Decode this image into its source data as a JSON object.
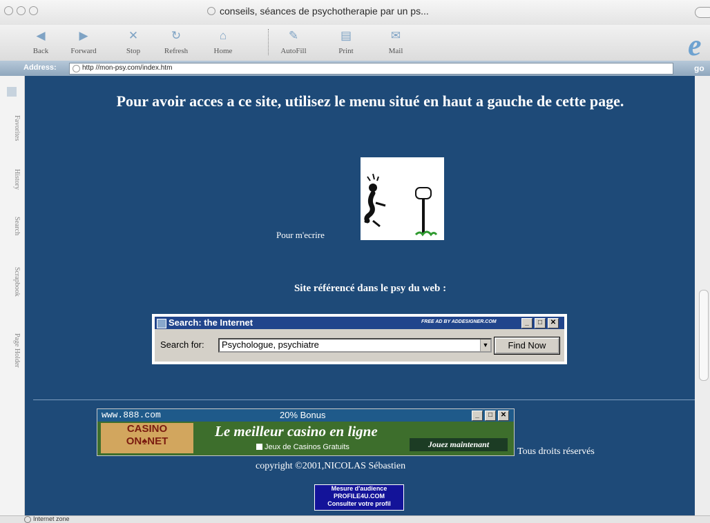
{
  "window": {
    "title": "conseils, séances de psychotherapie par un ps..."
  },
  "toolbar": {
    "buttons": [
      {
        "label": "Back",
        "icon": "back-arrow-icon"
      },
      {
        "label": "Forward",
        "icon": "forward-arrow-icon"
      },
      {
        "label": "Stop",
        "icon": "stop-x-icon"
      },
      {
        "label": "Refresh",
        "icon": "refresh-icon"
      },
      {
        "label": "Home",
        "icon": "home-icon"
      },
      {
        "label": "AutoFill",
        "icon": "autofill-icon"
      },
      {
        "label": "Print",
        "icon": "printer-icon"
      },
      {
        "label": "Mail",
        "icon": "mail-icon"
      }
    ]
  },
  "address_bar": {
    "label": "Address:",
    "url": "http //mon-psy.com/index.htm",
    "go_label": "go"
  },
  "explorer_bar": {
    "tabs": [
      "Favorites",
      "History",
      "Search",
      "Scrapbook",
      "Page Holder"
    ]
  },
  "page": {
    "heading": "Pour avoir acces a ce site, utilisez le menu situé en haut a gauche de cette page.",
    "mail_label": "Pour m'ecrire",
    "referenced_heading": "Site référencé dans le psy du web :",
    "search_widget": {
      "title": "Search: the Internet",
      "ad_text": "FREE AD BY ADDESIGNER.COM",
      "search_label": "Search for:",
      "selected_option": "Psychologue, psychiatre",
      "button_label": "Find Now"
    },
    "banner": {
      "url": "www.888.com",
      "bonus": "20% Bonus",
      "logo_line1": "CASINO",
      "logo_line2": "ON♠NET",
      "headline": "Le meilleur casino en ligne",
      "subtext": "Jeux de Casinos Gratuits",
      "play_button": "Jouez maintenant"
    },
    "rights": "Tous droits réservés",
    "copyright": "copyright ©2001,NICOLAS Sébastien",
    "audience_badge": {
      "line1": "Mesure d'audience",
      "line2": "PROFILE4U.COM",
      "line3": "Consulter votre profil"
    }
  },
  "status_bar": {
    "zone": "Internet zone"
  }
}
